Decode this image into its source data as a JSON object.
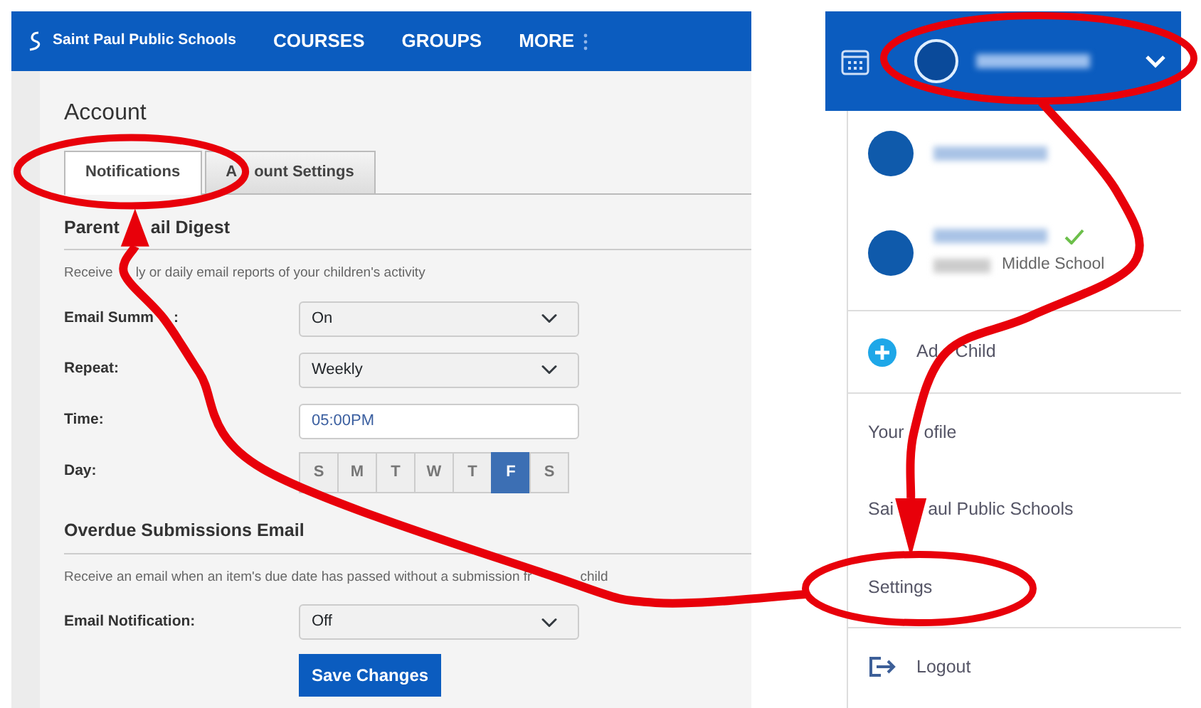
{
  "navbar": {
    "brand": "Saint Paul Public Schools",
    "links": [
      "COURSES",
      "GROUPS",
      "MORE"
    ]
  },
  "page_title": "Account",
  "tabs": [
    {
      "label": "Notifications",
      "selected": true
    },
    {
      "label": [
        "A",
        "ount Settings"
      ],
      "selected": false
    }
  ],
  "sections": [
    {
      "title": [
        "Parent",
        "ail Digest"
      ],
      "description": [
        "Receive",
        "ly or daily email reports of your children's activity"
      ],
      "fields": [
        {
          "kind": "select",
          "label": [
            "Email Summ",
            ":"
          ],
          "value": "On"
        },
        {
          "kind": "select",
          "label": "Repeat:",
          "value": "Weekly"
        },
        {
          "kind": "input",
          "label": "Time:",
          "value": "05:00PM"
        },
        {
          "kind": "days",
          "label": "Day:",
          "days": [
            {
              "label": "S",
              "selected": false
            },
            {
              "label": "M",
              "selected": false
            },
            {
              "label": "T",
              "selected": false
            },
            {
              "label": "W",
              "selected": false
            },
            {
              "label": "T",
              "selected": false
            },
            {
              "label": "F",
              "selected": true
            },
            {
              "label": "S",
              "selected": false
            }
          ]
        }
      ]
    },
    {
      "title": "Overdue Submissions Email",
      "description": [
        "Receive an email when an item's due date has passed without a submission fr",
        "child"
      ],
      "fields": [
        {
          "kind": "select",
          "label": "Email Notification:",
          "value": "Off"
        }
      ]
    }
  ],
  "save_button": "Save Changes",
  "profile_menu": {
    "items": [
      {
        "kind": "account"
      },
      {
        "kind": "child",
        "subtitle": "Middle School",
        "verified": true
      },
      {
        "kind": "add",
        "label": [
          "Ad",
          "Child"
        ]
      },
      {
        "kind": "link",
        "label": [
          "Your",
          "ofile"
        ]
      },
      {
        "kind": "link",
        "label": [
          "Sai",
          "aul Public Schools"
        ]
      },
      {
        "kind": "link",
        "label": "Settings"
      },
      {
        "kind": "logout",
        "label": "Logout"
      }
    ]
  }
}
